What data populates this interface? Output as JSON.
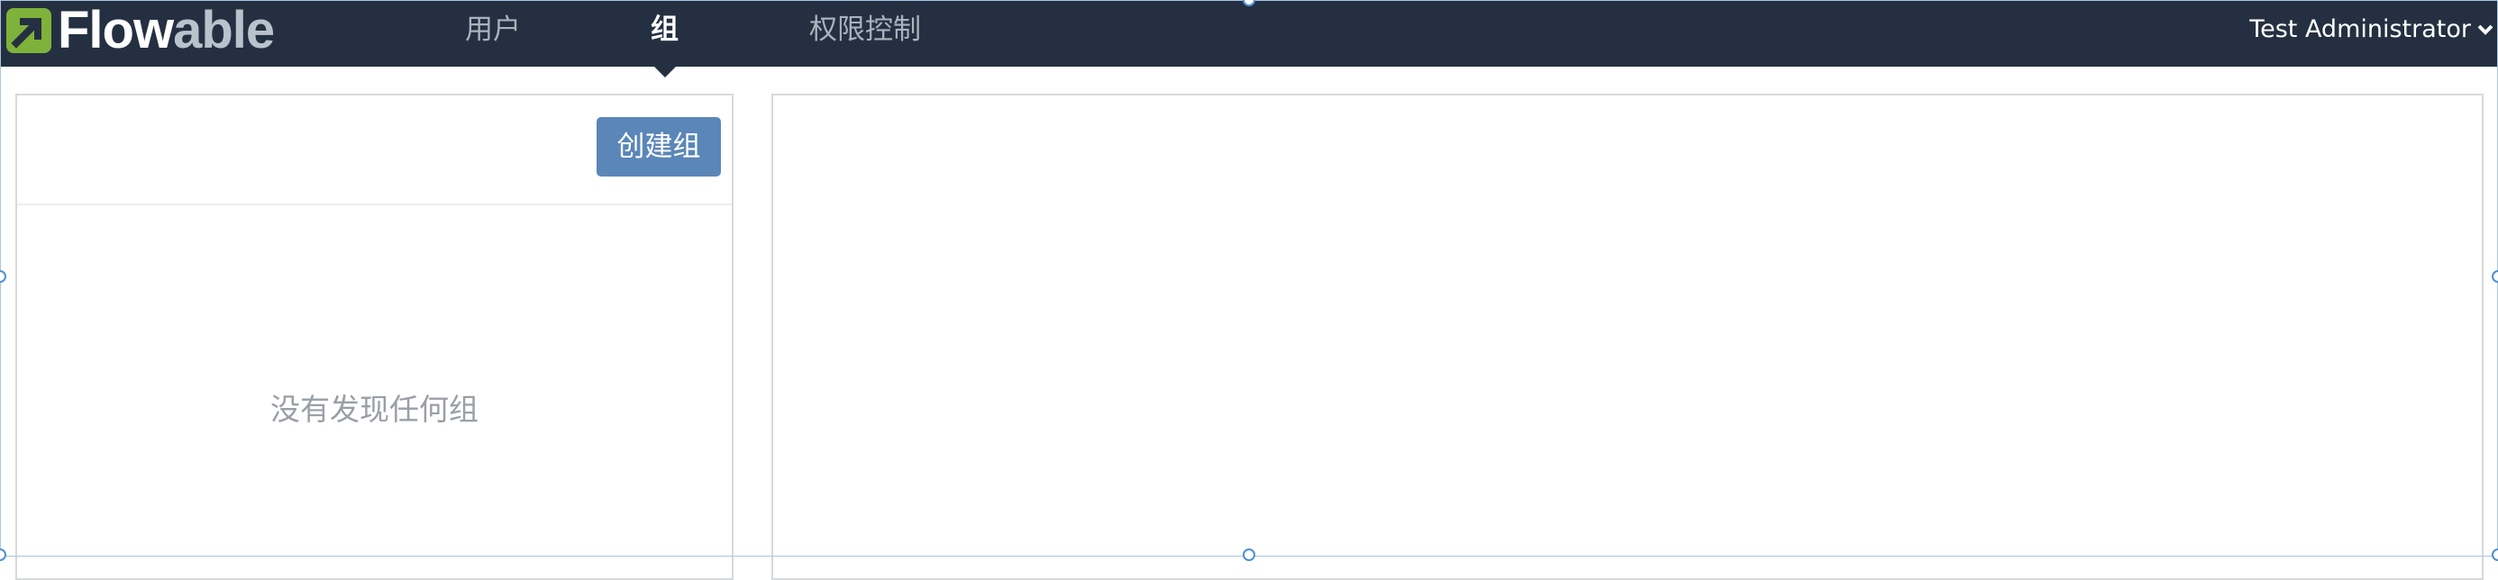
{
  "app": {
    "logo_text_primary": "Flow",
    "logo_text_secondary": "able",
    "brand_colors": {
      "navbar": "#243041",
      "logo_mark": "#7fb23a",
      "button": "#5b86b8"
    }
  },
  "nav": {
    "items": [
      {
        "label": "用户",
        "active": false
      },
      {
        "label": "组",
        "active": true
      },
      {
        "label": "权限控制",
        "active": false
      }
    ]
  },
  "user_menu": {
    "label": "Test Administrator",
    "icon": "chevron-down-icon"
  },
  "groups_panel": {
    "create_button_label": "创建组",
    "empty_message": "没有发现任何组"
  }
}
